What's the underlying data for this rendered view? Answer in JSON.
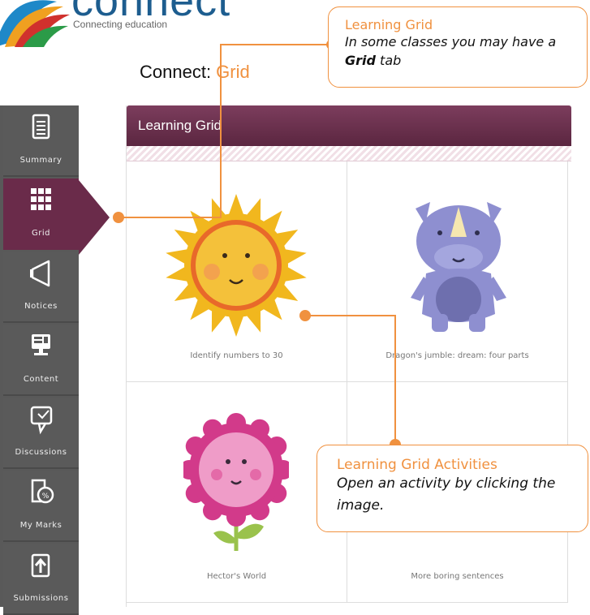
{
  "logo": {
    "word": "connect",
    "tagline": "Connecting education"
  },
  "heading": {
    "prefix": "Connect: ",
    "accent": "Grid"
  },
  "sidebar": {
    "items": [
      {
        "label": "Summary",
        "icon": "document-icon"
      },
      {
        "label": "Grid",
        "icon": "grid-icon",
        "active": true
      },
      {
        "label": "Notices",
        "icon": "megaphone-icon"
      },
      {
        "label": "Content",
        "icon": "monitor-icon"
      },
      {
        "label": "Discussions",
        "icon": "speech-bubble-icon"
      },
      {
        "label": "My Marks",
        "icon": "marks-icon"
      },
      {
        "label": "Submissions",
        "icon": "upload-icon"
      }
    ]
  },
  "panel": {
    "title": "Learning Grid",
    "activities": [
      {
        "caption": "Identify numbers to 30",
        "image": "sun"
      },
      {
        "caption": "Dragon's jumble: dream: four parts",
        "image": "rhino"
      },
      {
        "caption": "Hector's World",
        "image": "flower"
      },
      {
        "caption": "More boring sentences",
        "image": "none"
      }
    ]
  },
  "callouts": {
    "grid": {
      "title": "Learning Grid",
      "body_before": "In some classes you may have a ",
      "body_bold": "Grid",
      "body_after": " tab"
    },
    "activities": {
      "title": "Learning Grid Activities",
      "body": "Open an activity by clicking the image."
    }
  },
  "colors": {
    "accent_orange": "#f0913f",
    "header_plum": "#6a2b4a",
    "sidebar_grey": "#595959"
  }
}
